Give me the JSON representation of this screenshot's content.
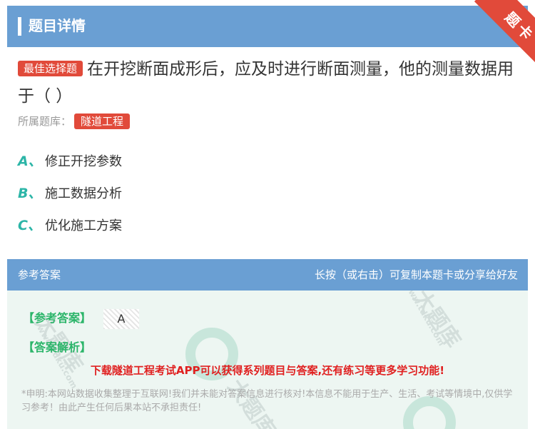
{
  "header": {
    "title": "题目详情",
    "ribbon": "题卡"
  },
  "question": {
    "tag": "最佳选择题",
    "text": "在开挖断面成形后，应及时进行断面测量，他的测量数据用于（ ）",
    "library_label": "所属题库：",
    "library": "隧道工程"
  },
  "options": [
    {
      "letter": "A、",
      "text": "修正开挖参数"
    },
    {
      "letter": "B、",
      "text": "施工数据分析"
    },
    {
      "letter": "C、",
      "text": "优化施工方案"
    }
  ],
  "answer": {
    "head_left": "参考答案",
    "head_right": "长按（或右击）可复制本题卡或分享给好友",
    "answer_label": "【参考答案】",
    "answer_value": "A",
    "analysis_label": "【答案解析】",
    "promo": "下载隧道工程考试APP可以获得系列题目与答案,还有练习等更多学习功能!",
    "disclaimer": "*申明:本网站数据收集整理于互联网!我们并未能对答案信息进行核对!本信息不能用于生产、生活、考试等情境中,仅供学习参考！由此产生任何后果本站不承担责任!"
  },
  "watermark": {
    "site": "www.tdkü.com",
    "brand": "大题库"
  }
}
